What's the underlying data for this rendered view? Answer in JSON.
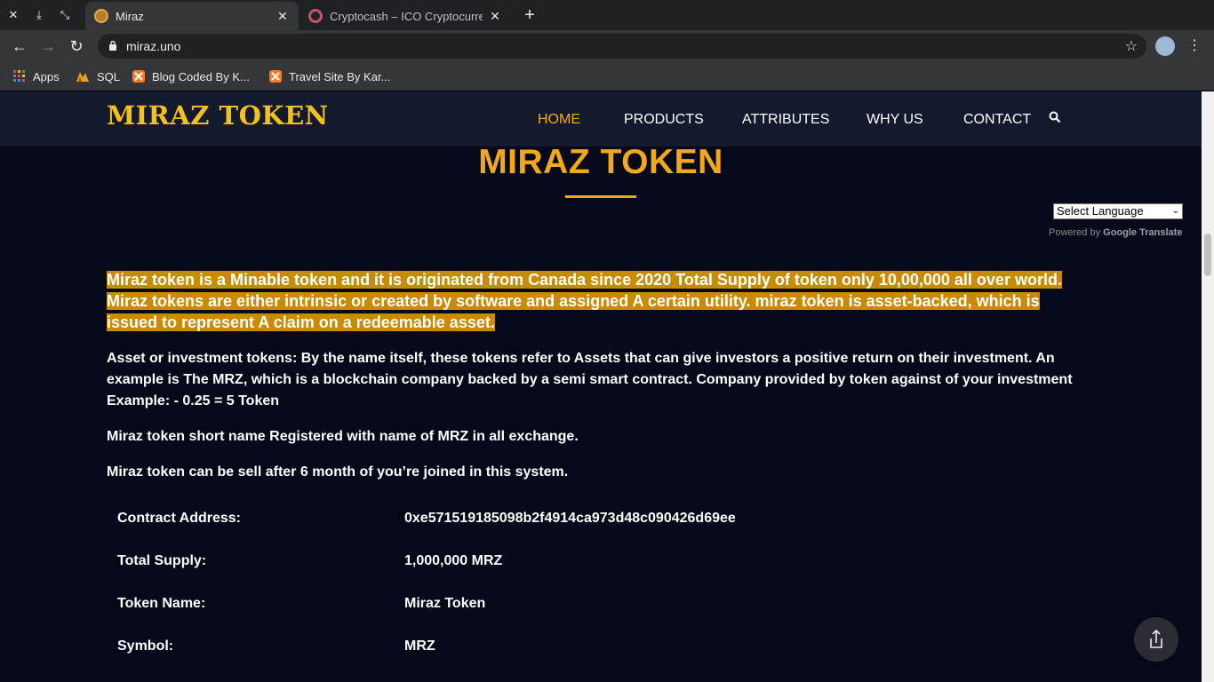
{
  "browser": {
    "tabs": [
      {
        "title": "Miraz",
        "active": true
      },
      {
        "title": "Cryptocash – ICO Cryptocurrency",
        "active": false
      }
    ],
    "url": "miraz.uno",
    "bookmarks": [
      {
        "label": "Apps"
      },
      {
        "label": "SQL"
      },
      {
        "label": "Blog Coded By K..."
      },
      {
        "label": "Travel Site By Kar..."
      }
    ]
  },
  "site": {
    "logo": "MIRAZ TOKEN",
    "nav": [
      "HOME",
      "PRODUCTS",
      "ATTRIBUTES",
      "WHY US",
      "CONTACT"
    ],
    "active_nav": "HOME",
    "accent_color": "#f2a81c",
    "hero_title": "MIRAZ TOKEN",
    "translate": {
      "select_label": "Select Language",
      "powered_by": "Powered by",
      "google": "Google",
      "translate": "Translate"
    },
    "highlight_paragraph": "Miraz token is a Minable token and it is originated from Canada since 2020 Total Supply of token only 10,00,000 all over world. Miraz tokens are either intrinsic or created by software and assigned A certain utility. miraz token is asset-backed, which is issued to represent A claim on a redeemable asset.",
    "paragraphs": [
      "Asset or investment tokens: By the name itself, these tokens refer to Assets that can give investors a positive return on their investment. An example is The MRZ, which is a blockchain company backed by a semi smart contract. Company provided by token against of your investment Example: - 0.25 = 5 Token",
      "Miraz token short name Registered with name of MRZ in all exchange.",
      "Miraz token can be sell after 6 month of you’re joined in this system."
    ],
    "token_info": [
      {
        "label": "Contract Address:",
        "value": "0xe571519185098b2f4914ca973d48c090426d69ee"
      },
      {
        "label": "Total Supply:",
        "value": "1,000,000 MRZ"
      },
      {
        "label": "Token Name:",
        "value": "Miraz Token"
      },
      {
        "label": "Symbol:",
        "value": "MRZ"
      }
    ]
  }
}
